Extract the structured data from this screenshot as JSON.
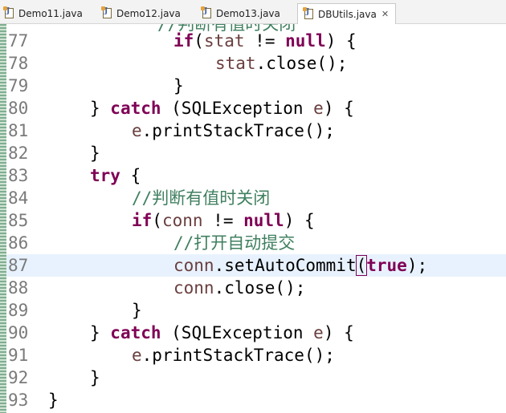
{
  "tabs": [
    {
      "label": "Demo11.java",
      "active": false
    },
    {
      "label": "Demo12.java",
      "active": false
    },
    {
      "label": "Demo13.java",
      "active": false
    },
    {
      "label": "DBUtils.java",
      "active": true
    }
  ],
  "top_partial_comment": "//判断有值时关闭",
  "lines": [
    {
      "num": "77",
      "indent": 4,
      "tokens": [
        {
          "t": "if",
          "c": "kw"
        },
        {
          "t": "(",
          "c": ""
        },
        {
          "t": "stat",
          "c": "vr"
        },
        {
          "t": " != ",
          "c": ""
        },
        {
          "t": "null",
          "c": "kw"
        },
        {
          "t": ") {",
          "c": ""
        }
      ]
    },
    {
      "num": "78",
      "indent": 5,
      "tokens": [
        {
          "t": "stat",
          "c": "vr"
        },
        {
          "t": ".close();",
          "c": ""
        }
      ]
    },
    {
      "num": "79",
      "indent": 4,
      "tokens": [
        {
          "t": "}",
          "c": ""
        }
      ]
    },
    {
      "num": "80",
      "indent": 2,
      "tokens": [
        {
          "t": "} ",
          "c": ""
        },
        {
          "t": "catch",
          "c": "kw"
        },
        {
          "t": " (SQLException ",
          "c": ""
        },
        {
          "t": "e",
          "c": "vr"
        },
        {
          "t": ") {",
          "c": ""
        }
      ]
    },
    {
      "num": "81",
      "indent": 3,
      "tokens": [
        {
          "t": "e",
          "c": "vr"
        },
        {
          "t": ".printStackTrace();",
          "c": ""
        }
      ]
    },
    {
      "num": "82",
      "indent": 2,
      "tokens": [
        {
          "t": "}",
          "c": ""
        }
      ]
    },
    {
      "num": "83",
      "indent": 2,
      "tokens": [
        {
          "t": "try",
          "c": "kw"
        },
        {
          "t": " {",
          "c": ""
        }
      ]
    },
    {
      "num": "84",
      "indent": 3,
      "tokens": [
        {
          "t": "//判断有值时关闭",
          "c": "cm"
        }
      ]
    },
    {
      "num": "85",
      "indent": 3,
      "tokens": [
        {
          "t": "if",
          "c": "kw"
        },
        {
          "t": "(",
          "c": ""
        },
        {
          "t": "conn",
          "c": "vr"
        },
        {
          "t": " != ",
          "c": ""
        },
        {
          "t": "null",
          "c": "kw"
        },
        {
          "t": ") {",
          "c": ""
        }
      ]
    },
    {
      "num": "86",
      "indent": 4,
      "tokens": [
        {
          "t": "//打开自动提交",
          "c": "cm"
        }
      ]
    },
    {
      "num": "87",
      "indent": 4,
      "current": true,
      "tokens": [
        {
          "t": "conn",
          "c": "vr"
        },
        {
          "t": ".setAutoCommit",
          "c": ""
        },
        {
          "t": "(",
          "c": "bm"
        },
        {
          "t": "true",
          "c": "kw"
        },
        {
          "t": ");",
          "c": ""
        }
      ]
    },
    {
      "num": "88",
      "indent": 4,
      "tokens": [
        {
          "t": "conn",
          "c": "vr"
        },
        {
          "t": ".close();",
          "c": ""
        }
      ]
    },
    {
      "num": "89",
      "indent": 3,
      "tokens": [
        {
          "t": "}",
          "c": ""
        }
      ]
    },
    {
      "num": "90",
      "indent": 2,
      "tokens": [
        {
          "t": "} ",
          "c": ""
        },
        {
          "t": "catch",
          "c": "kw"
        },
        {
          "t": " (SQLException ",
          "c": ""
        },
        {
          "t": "e",
          "c": "vr"
        },
        {
          "t": ") {",
          "c": ""
        }
      ]
    },
    {
      "num": "91",
      "indent": 3,
      "tokens": [
        {
          "t": "e",
          "c": "vr"
        },
        {
          "t": ".printStackTrace();",
          "c": ""
        }
      ]
    },
    {
      "num": "92",
      "indent": 2,
      "tokens": [
        {
          "t": "}",
          "c": ""
        }
      ]
    },
    {
      "num": "93",
      "indent": 1,
      "tokens": [
        {
          "t": "}",
          "c": ""
        }
      ]
    }
  ]
}
